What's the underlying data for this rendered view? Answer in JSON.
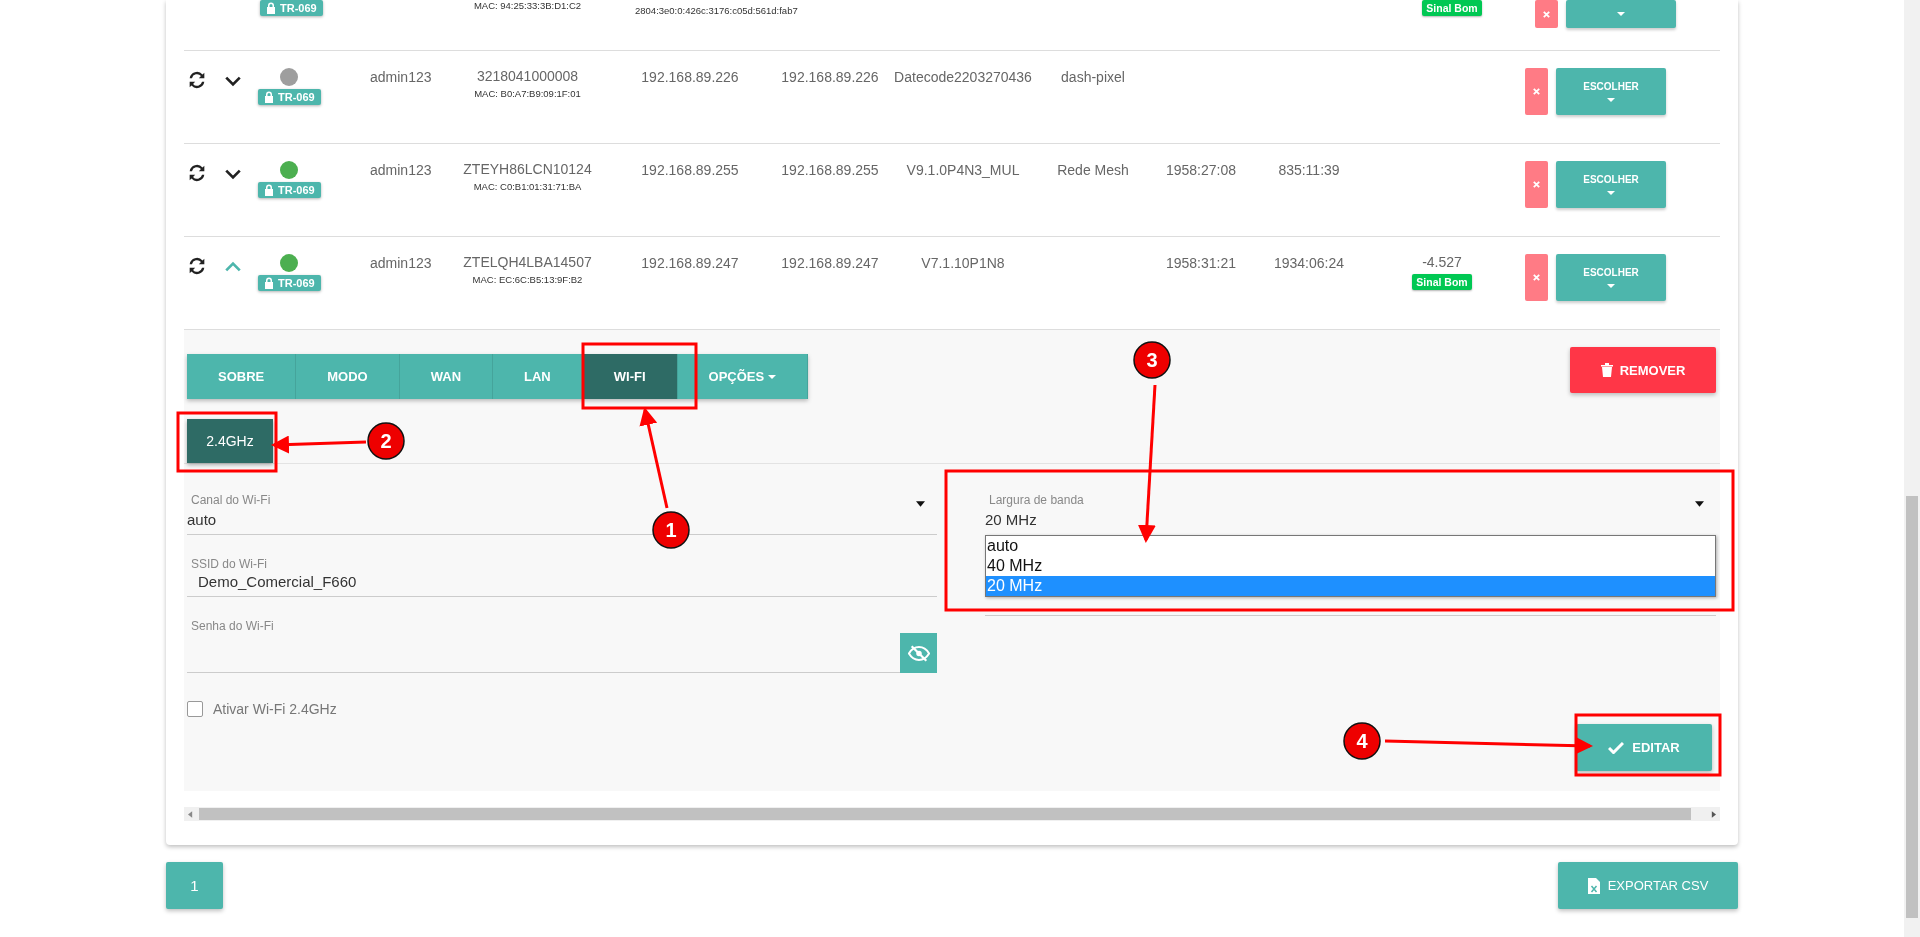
{
  "rows": [
    {
      "kind": "partial",
      "badge": "TR-069",
      "mac": "MAC: 94:25:33:3B:D1:C2",
      "ipv6": "2804:3e0:0:426c:3176:c05d:561d:fab7",
      "signal_badge": "Sinal Bom"
    },
    {
      "kind": "full",
      "expanded": false,
      "color": "#9e9e9e",
      "badge": "TR-069",
      "user": "admin123",
      "serial": "3218041000008",
      "mac": "MAC: B0:A7:B9:09:1F:01",
      "ip": "192.168.89.226",
      "ip_alt": "192.168.89.226",
      "firmware": "Datecode2203270436",
      "name": "dash-pixel",
      "choose_button": "ESCOLHER"
    },
    {
      "kind": "full",
      "expanded": false,
      "color": "#4caf50",
      "badge": "TR-069",
      "user": "admin123",
      "serial": "ZTEYH86LCN10124",
      "mac": "MAC: C0:B1:01:31:71:BA",
      "ip": "192.168.89.255",
      "ip_alt": "192.168.89.255",
      "firmware": "V9.1.0P4N3_MUL",
      "name": "Rede Mesh",
      "time_1": "1958:27:08",
      "time_2": "835:11:39",
      "choose_button": "ESCOLHER"
    },
    {
      "kind": "full",
      "expanded": true,
      "color": "#4caf50",
      "badge": "TR-069",
      "user": "admin123",
      "serial": "ZTELQH4LBA14507",
      "mac": "MAC: EC:6C:B5:13:9F:B2",
      "ip": "192.168.89.247",
      "ip_alt": "192.168.89.247",
      "firmware": "V7.1.10P1N8",
      "time_1": "1958:31:21",
      "time_2": "1934:06:24",
      "signal": "-4.527",
      "signal_badge": "Sinal Bom",
      "choose_button": "ESCOLHER"
    }
  ],
  "detail": {
    "tabs": [
      {
        "label": "SOBRE",
        "selected": false
      },
      {
        "label": "MODO",
        "selected": false
      },
      {
        "label": "WAN",
        "selected": false
      },
      {
        "label": "LAN",
        "selected": false
      },
      {
        "label": "WI-FI",
        "selected": true
      },
      {
        "label": "OPÇÕES",
        "selected": false,
        "kind": "dropdown"
      }
    ],
    "remove_button": "REMOVER",
    "bands": [
      {
        "label": "2.4GHz",
        "selected": true
      }
    ],
    "fields": [
      {
        "kind": "select",
        "label": "Canal do Wi-Fi",
        "value": "auto"
      },
      {
        "kind": "text",
        "label": "SSID do Wi-Fi",
        "value": "Demo_Comercial_F660"
      },
      {
        "kind": "password",
        "label": "Senha do Wi-Fi"
      }
    ],
    "checkbox": {
      "label": "Ativar Wi-Fi 2.4GHz",
      "checked": false
    },
    "bandwidth": {
      "label": "Largura de banda",
      "value": "20 MHz",
      "options": [
        {
          "label": "auto",
          "selected": false
        },
        {
          "label": "40 MHz",
          "selected": false
        },
        {
          "label": "20 MHz",
          "selected": true
        }
      ]
    },
    "edit_button": "EDITAR"
  },
  "pages": [
    {
      "label": "1",
      "selected": true
    }
  ],
  "export_button": "EXPORTAR CSV",
  "annotations": [
    {
      "label": "1"
    },
    {
      "label": "2"
    },
    {
      "label": "3"
    },
    {
      "label": "4"
    }
  ]
}
